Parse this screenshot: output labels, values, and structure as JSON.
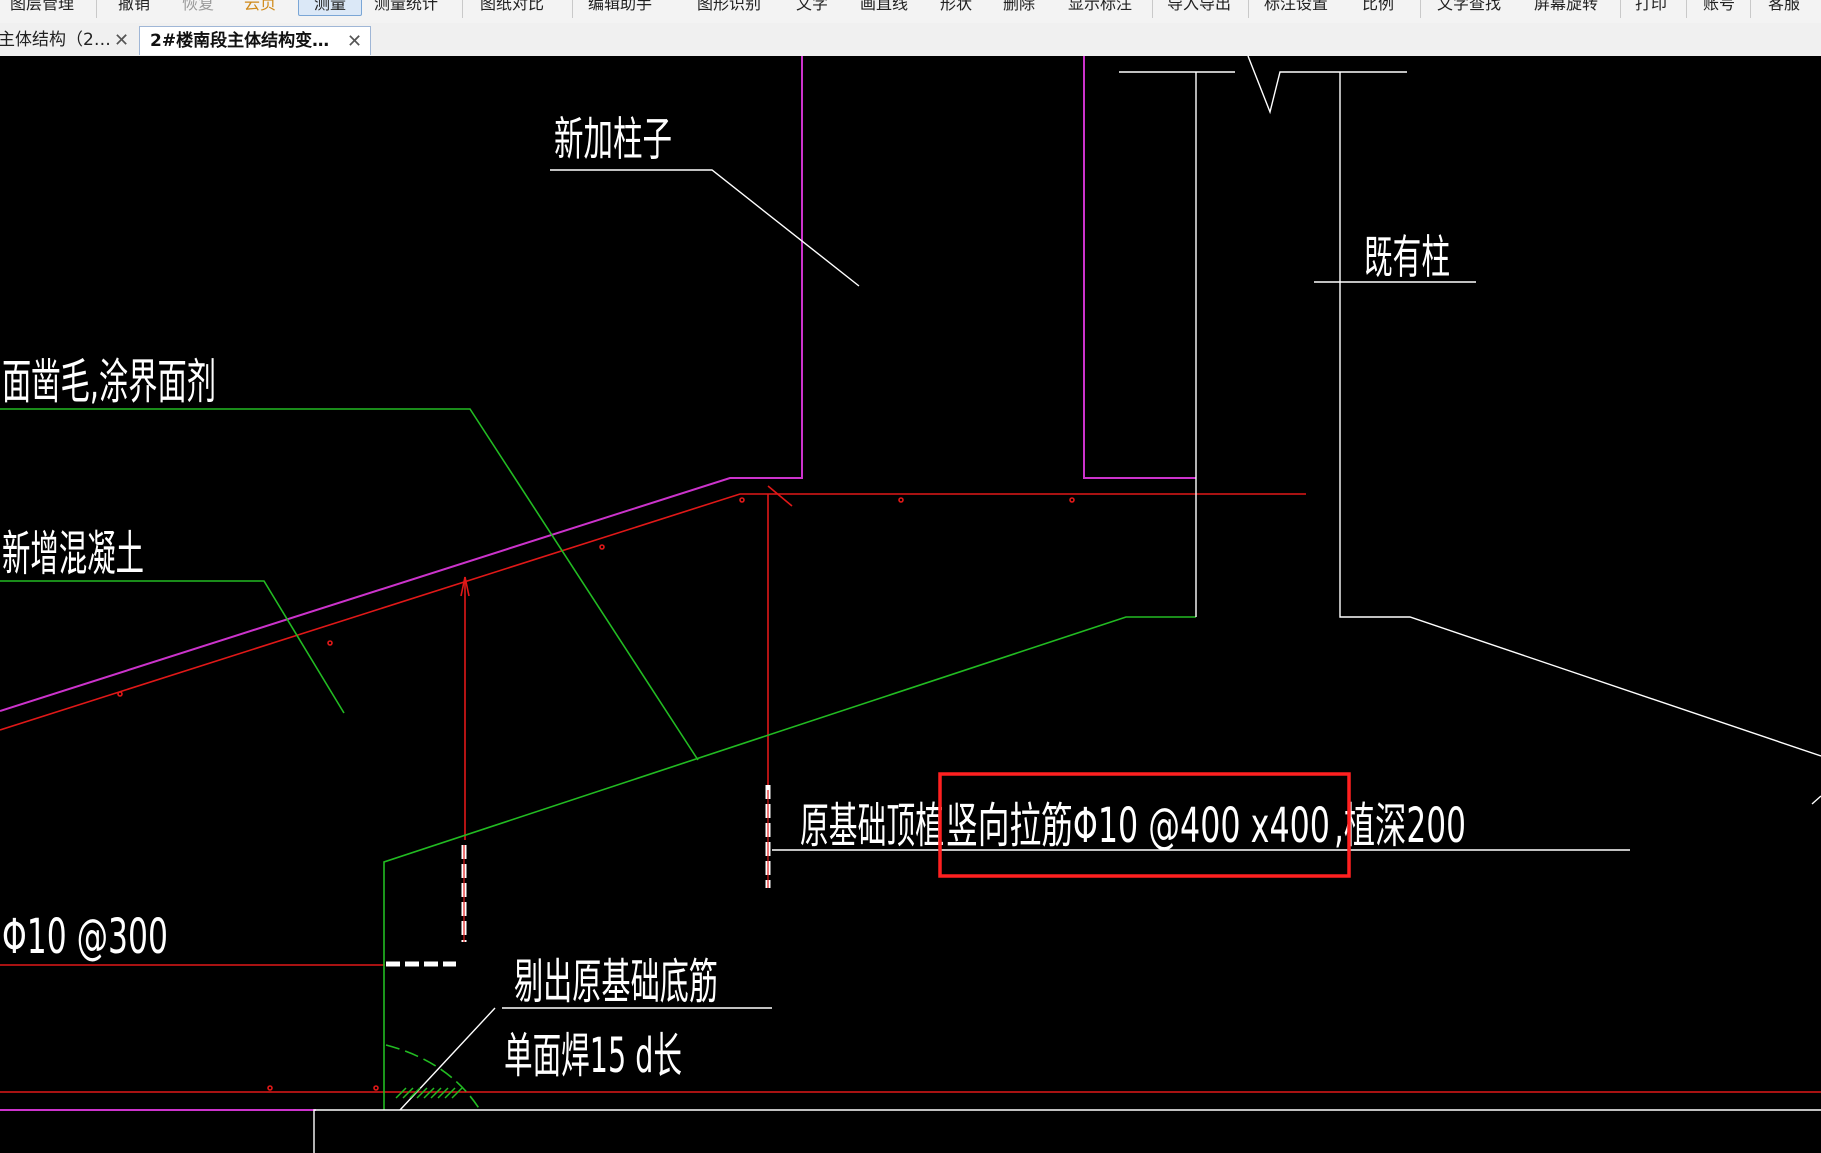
{
  "toolbar": {
    "items": [
      {
        "label": "图层管理",
        "style": "normal"
      },
      {
        "label": "撤销",
        "style": "normal"
      },
      {
        "label": "恢复",
        "style": "dim"
      },
      {
        "label": "云页",
        "style": "orange"
      },
      {
        "label": "测量",
        "style": "active"
      },
      {
        "label": "测量统计",
        "style": "normal"
      },
      {
        "label": "图纸对比",
        "style": "normal"
      },
      {
        "label": "编辑助手",
        "style": "normal"
      },
      {
        "label": "图形识别",
        "style": "normal"
      },
      {
        "label": "文字",
        "style": "normal"
      },
      {
        "label": "画直线",
        "style": "normal"
      },
      {
        "label": "形状",
        "style": "normal"
      },
      {
        "label": "删除",
        "style": "normal"
      },
      {
        "label": "显示标注",
        "style": "normal"
      },
      {
        "label": "导入导出",
        "style": "normal"
      },
      {
        "label": "标注设置",
        "style": "normal"
      },
      {
        "label": "比例",
        "style": "normal"
      },
      {
        "label": "文字查找",
        "style": "normal"
      },
      {
        "label": "屏幕旋转",
        "style": "normal"
      },
      {
        "label": "打印",
        "style": "normal"
      },
      {
        "label": "账号",
        "style": "normal"
      },
      {
        "label": "客服",
        "style": "normal"
      }
    ]
  },
  "tabs": [
    {
      "label": "主体结构（2…",
      "active": false,
      "close": "✕"
    },
    {
      "label": "2#楼南段主体结构变…",
      "active": true,
      "close": "✕"
    }
  ],
  "drawing": {
    "labels": {
      "new_column": "新加柱子",
      "existing_column": "既有柱",
      "chisel_note": "面凿毛,涂界面剂",
      "new_concrete": "新增混凝土",
      "rebar_spacing": "Φ10 @300",
      "vertical_rebar_part1": "原基础顶植",
      "vertical_rebar_part2": "竖向拉筋Φ10 @400 x400",
      "vertical_rebar_part3": ",植深200",
      "bottom_rebar": "剔出原基础底筋",
      "weld_note": "单面焊15 d长"
    },
    "colors": {
      "background": "#000000",
      "column_outline": "#cc33cc",
      "rebar_line": "#e01818",
      "concrete_outline": "#22bb22",
      "annotation": "#ffffff",
      "highlight_box": "#ff2020"
    }
  }
}
